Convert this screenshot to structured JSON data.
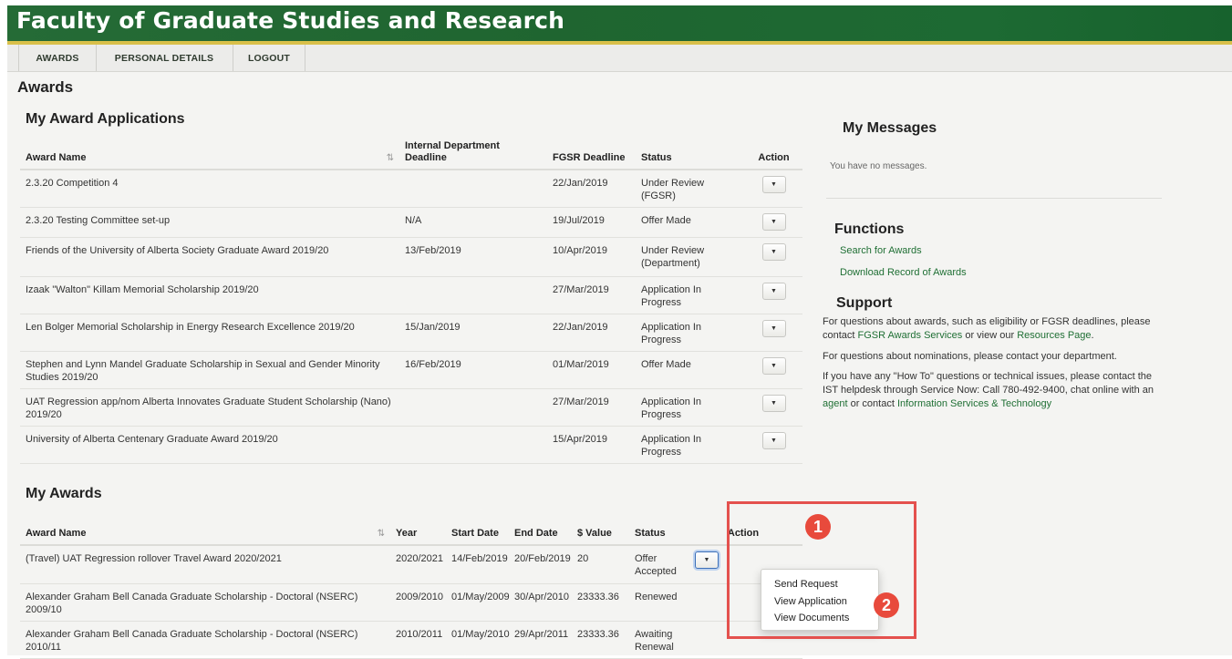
{
  "header": {
    "title": "Faculty of Graduate Studies and Research"
  },
  "nav": {
    "items": [
      "AWARDS",
      "PERSONAL DETAILS",
      "LOGOUT"
    ]
  },
  "page_title": "Awards",
  "applications": {
    "title": "My Award Applications",
    "columns": {
      "award_name": "Award Name",
      "dept_deadline": "Internal Department Deadline",
      "fgsr_deadline": "FGSR Deadline",
      "status": "Status",
      "action": "Action"
    },
    "rows": [
      {
        "name": "2.3.20 Competition 4",
        "dept": "",
        "fgsr": "22/Jan/2019",
        "status": "Under Review (FGSR)"
      },
      {
        "name": "2.3.20 Testing Committee set-up",
        "dept": "N/A",
        "fgsr": "19/Jul/2019",
        "status": "Offer Made"
      },
      {
        "name": "Friends of the University of Alberta Society Graduate Award 2019/20",
        "dept": "13/Feb/2019",
        "fgsr": "10/Apr/2019",
        "status": "Under Review (Department)"
      },
      {
        "name": "Izaak \"Walton\" Killam Memorial Scholarship 2019/20",
        "dept": "",
        "fgsr": "27/Mar/2019",
        "status": "Application In Progress"
      },
      {
        "name": "Len Bolger Memorial Scholarship in Energy Research Excellence 2019/20",
        "dept": "15/Jan/2019",
        "fgsr": "22/Jan/2019",
        "status": "Application In Progress"
      },
      {
        "name": "Stephen and Lynn Mandel Graduate Scholarship in Sexual and Gender Minority Studies 2019/20",
        "dept": "16/Feb/2019",
        "fgsr": "01/Mar/2019",
        "status": "Offer Made"
      },
      {
        "name": "UAT Regression app/nom Alberta Innovates Graduate Student Scholarship (Nano) 2019/20",
        "dept": "",
        "fgsr": "27/Mar/2019",
        "status": "Application In Progress"
      },
      {
        "name": "University of Alberta Centenary Graduate Award 2019/20",
        "dept": "",
        "fgsr": "15/Apr/2019",
        "status": "Application In Progress"
      }
    ]
  },
  "awards": {
    "title": "My Awards",
    "columns": {
      "award_name": "Award Name",
      "year": "Year",
      "start": "Start Date",
      "end": "End Date",
      "value": "$ Value",
      "status": "Status",
      "action": "Action"
    },
    "rows": [
      {
        "name": "(Travel) UAT Regression rollover Travel Award 2020/2021",
        "year": "2020/2021",
        "start": "14/Feb/2019",
        "end": "20/Feb/2019",
        "value": "20",
        "status": "Offer Accepted"
      },
      {
        "name": "Alexander Graham Bell Canada Graduate Scholarship - Doctoral (NSERC) 2009/10",
        "year": "2009/2010",
        "start": "01/May/2009",
        "end": "30/Apr/2010",
        "value": "23333.36",
        "status": "Renewed"
      },
      {
        "name": "Alexander Graham Bell Canada Graduate Scholarship - Doctoral (NSERC) 2010/11",
        "year": "2010/2011",
        "start": "01/May/2010",
        "end": "29/Apr/2011",
        "value": "23333.36",
        "status": "Awaiting Renewal"
      }
    ]
  },
  "dropdown": {
    "items": [
      "Send Request",
      "View Application",
      "View Documents"
    ]
  },
  "callouts": {
    "one": "1",
    "two": "2"
  },
  "messages": {
    "title": "My Messages",
    "empty": "You have no messages."
  },
  "functions": {
    "title": "Functions",
    "links": [
      "Search for Awards",
      "Download Record of Awards"
    ]
  },
  "support": {
    "title": "Support",
    "p1_a": "For questions about awards, such as eligibility or FGSR deadlines, please contact ",
    "p1_link1": "FGSR Awards Services",
    "p1_b": " or view our ",
    "p1_link2": "Resources Page",
    "p1_c": ".",
    "p2": "For questions about nominations, please contact your department.",
    "p3_a": "If you have any \"How To\" questions or technical issues, please contact the IST helpdesk through Service Now: Call 780-492-9400, chat online with an ",
    "p3_link1": "agent",
    "p3_b": " or contact ",
    "p3_link2": "Information Services & Technology"
  },
  "colors": {
    "header_green": "#1f6530",
    "gold": "#d9c04a",
    "link_green": "#1f6f34",
    "callout_red": "#e84a3c"
  }
}
